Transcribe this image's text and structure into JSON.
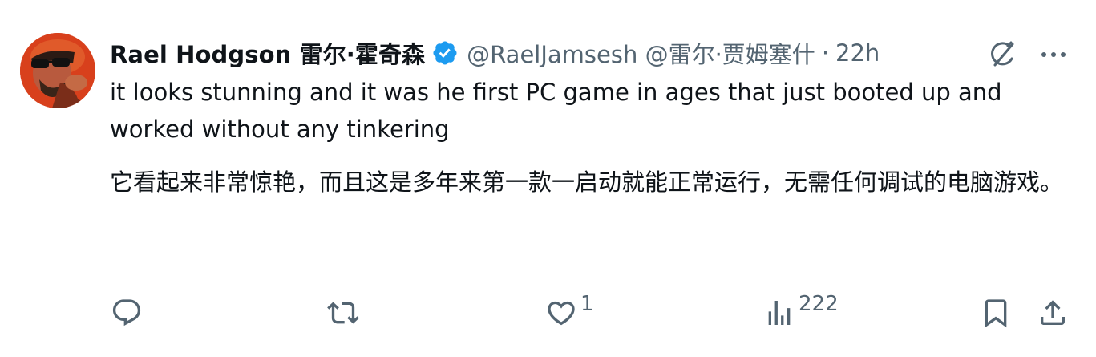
{
  "tweet": {
    "display_name": "Rael Hodgson 雷尔·霍奇森",
    "handle": "@RaelJamsesh @雷尔·贾姆塞什",
    "separator": "·",
    "time": "22h",
    "text_en": "it looks stunning and it was he first PC game in ages that just booted up and worked without any tinkering",
    "text_zh": "它看起来非常惊艳，而且这是多年来第一款一启动就能正常运行，无需任何调试的电脑游戏。"
  },
  "actions": {
    "reply_count": "",
    "retweet_count": "",
    "like_count": "1",
    "views_count": "222"
  },
  "icons": {
    "verified": "verified-badge-icon",
    "grok": "grok-icon",
    "more": "more-icon",
    "reply": "reply-icon",
    "retweet": "retweet-icon",
    "like": "heart-icon",
    "views": "views-icon",
    "bookmark": "bookmark-icon",
    "share": "share-icon"
  },
  "colors": {
    "text_primary": "#0f1419",
    "text_secondary": "#536471",
    "verified_blue": "#1d9bf0",
    "avatar_bg": "#d9421d"
  }
}
